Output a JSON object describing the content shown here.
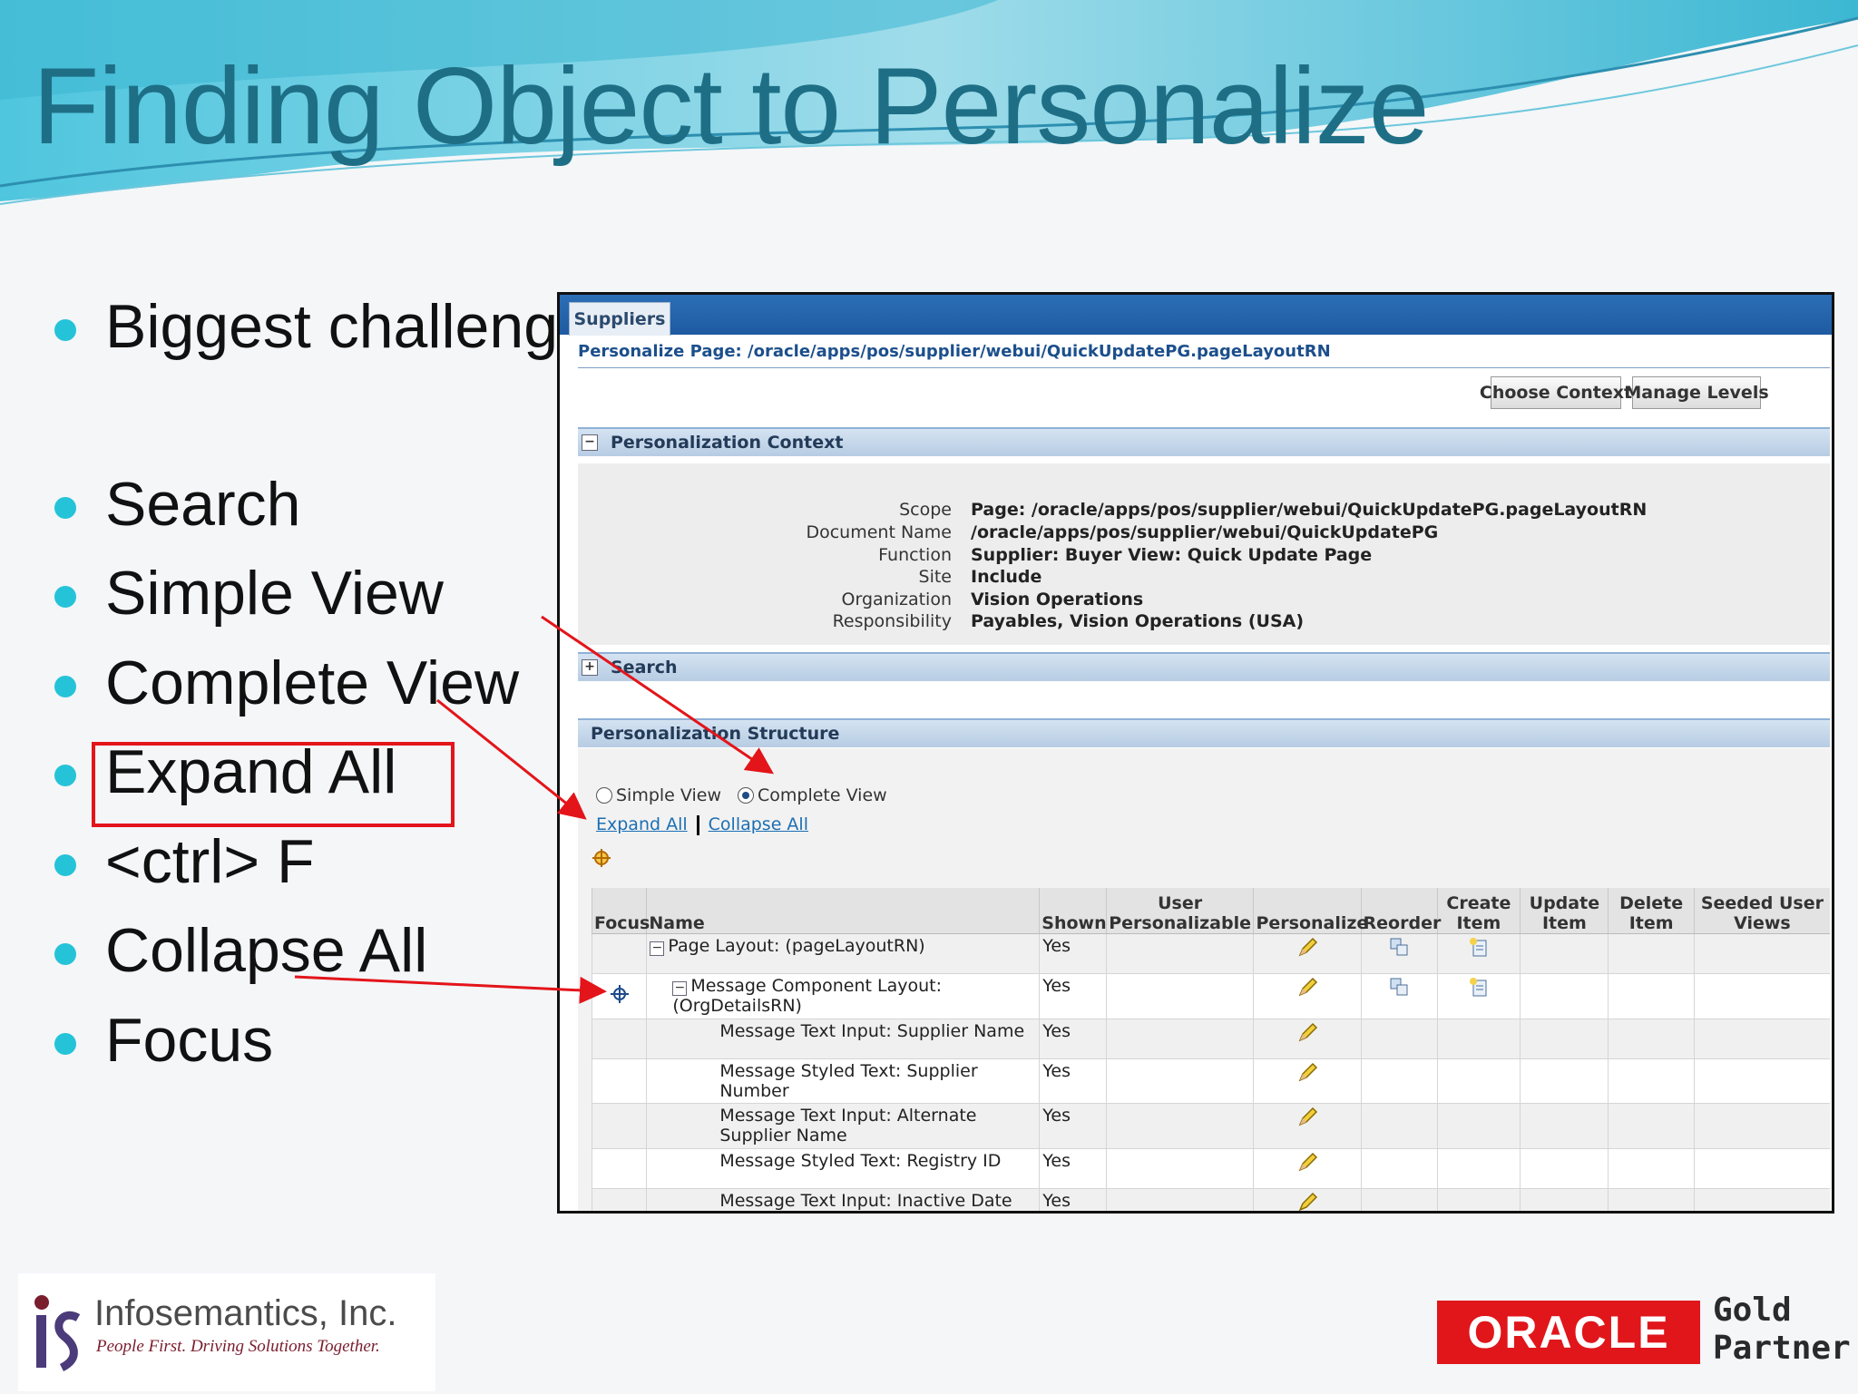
{
  "title": "Finding Object to Personalize",
  "bullets": [
    "Biggest challenge",
    "Search",
    "Simple View",
    "Complete View",
    "Expand All",
    "<ctrl> F",
    "Collapse All",
    "Focus"
  ],
  "screenshot": {
    "tab": "Suppliers",
    "page_header": "Personalize Page: /oracle/apps/pos/supplier/webui/QuickUpdatePG.pageLayoutRN",
    "buttons": {
      "choose_context": "Choose Context",
      "manage_levels": "Manage Levels"
    },
    "context_section": "Personalization Context",
    "context": [
      {
        "label": "Scope",
        "value": "Page: /oracle/apps/pos/supplier/webui/QuickUpdatePG.pageLayoutRN"
      },
      {
        "label": "Document Name",
        "value": "/oracle/apps/pos/supplier/webui/QuickUpdatePG"
      },
      {
        "label": "Function",
        "value": "Supplier: Buyer View: Quick Update Page"
      },
      {
        "label": "Site",
        "value": "Include"
      },
      {
        "label": "Organization",
        "value": "Vision Operations"
      },
      {
        "label": "Responsibility",
        "value": "Payables, Vision Operations (USA)"
      }
    ],
    "search_section": "Search",
    "structure_section": "Personalization Structure",
    "radios": {
      "simple": "Simple View",
      "complete": "Complete View",
      "selected": "complete"
    },
    "links": {
      "expand_all": "Expand All",
      "collapse_all": "Collapse All"
    },
    "table": {
      "headers": [
        "Focus",
        "Name",
        "Shown",
        "User Personalizable",
        "Personalize",
        "Reorder",
        "Create Item",
        "Update Item",
        "Delete Item",
        "Seeded User Views"
      ],
      "rows": [
        {
          "name": "Page Layout: (pageLayoutRN)",
          "shown": "Yes"
        },
        {
          "name": "Message Component Layout: (OrgDetailsRN)",
          "shown": "Yes"
        },
        {
          "name": "Message Text Input: Supplier Name",
          "shown": "Yes"
        },
        {
          "name": "Message Styled Text: Supplier Number",
          "shown": "Yes"
        },
        {
          "name": "Message Text Input: Alternate Supplier Name",
          "shown": "Yes"
        },
        {
          "name": "Message Styled Text: Registry ID",
          "shown": "Yes"
        },
        {
          "name": "Message Text Input: Inactive Date",
          "shown": "Yes"
        }
      ]
    }
  },
  "footer": {
    "company": "Infosemantics, Inc.",
    "tagline": "People First. Driving Solutions Together.",
    "oracle": "ORACLE",
    "partner": [
      "Gold",
      "Partner"
    ]
  },
  "colors": {
    "title": "#1e6f86",
    "bullet": "#25c3d8",
    "highlight": "#e3151a",
    "oracle_red": "#e0161b"
  }
}
